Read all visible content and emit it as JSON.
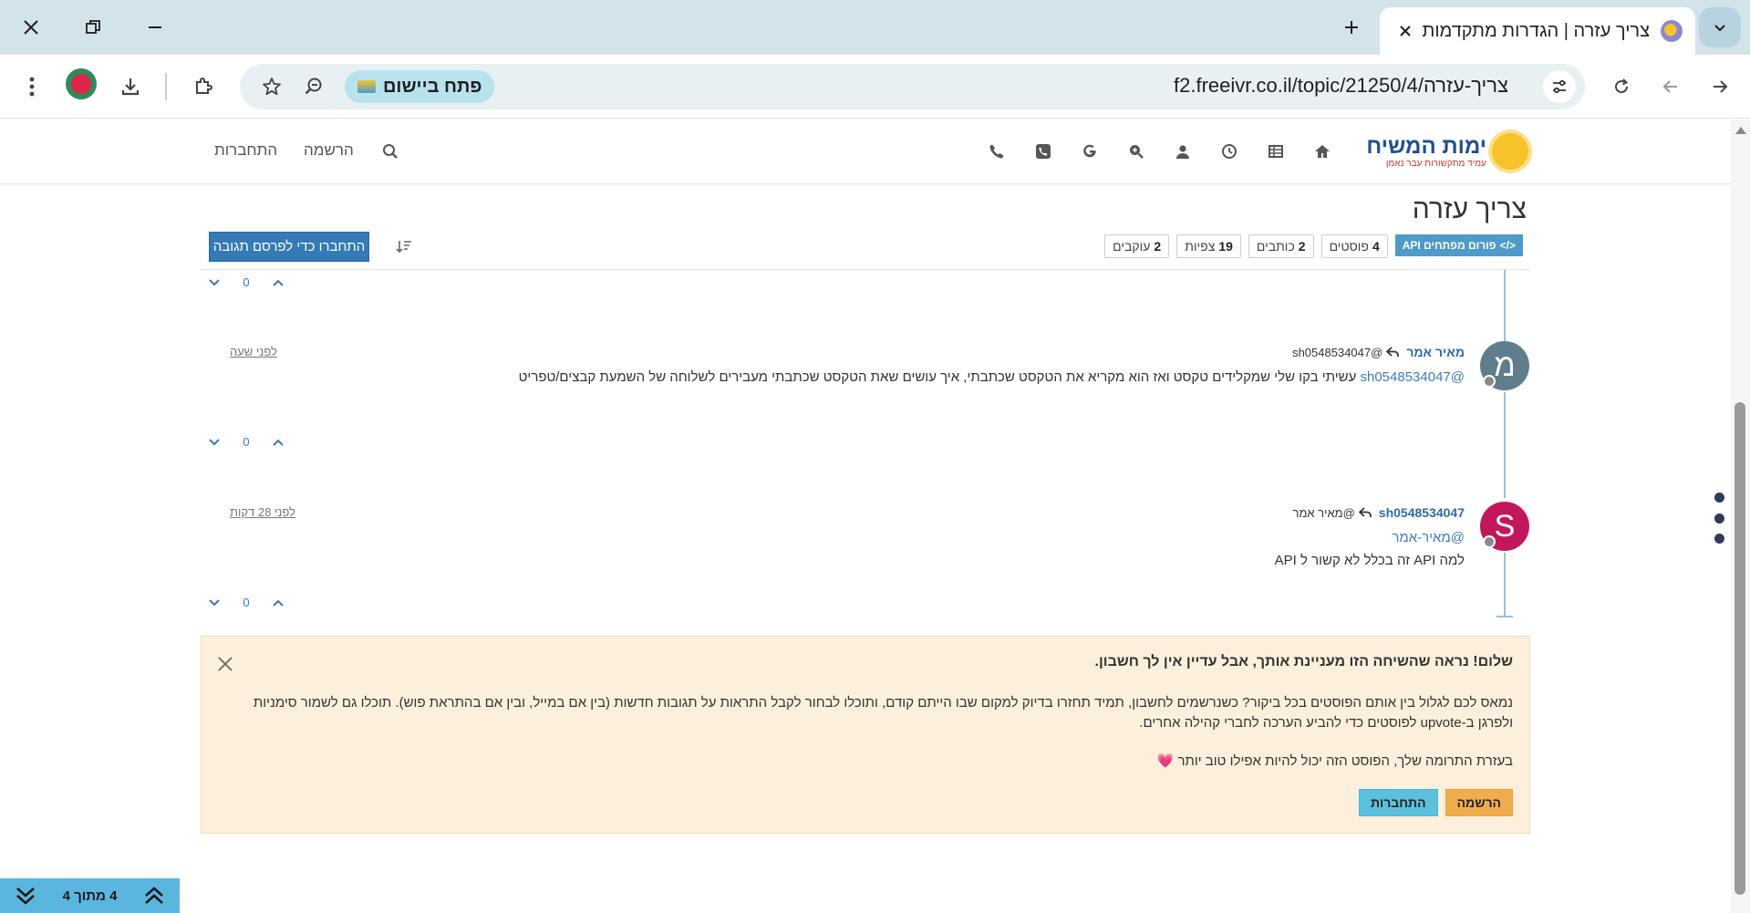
{
  "browser": {
    "tab_title": "צריך עזרה | הגדרות מתקדמות - ימות המשיח",
    "url": "f2.freeivr.co.il/topic/21250/4/צריך-עזרה",
    "open_app_label": "פתח ביישום"
  },
  "site": {
    "logo_main": "ימות המשיח",
    "logo_sub": "עמיד מתקשורות עבר נאמן",
    "register_link": "הרשמה",
    "login_link": "התחברות"
  },
  "topic": {
    "title": "צריך עזרה",
    "category_badge": "פורום מפתחים API",
    "stats": [
      {
        "count": "4",
        "label": "פוסטים"
      },
      {
        "count": "2",
        "label": "כותבים"
      },
      {
        "count": "19",
        "label": "צפיות"
      },
      {
        "count": "2",
        "label": "עוקבים"
      }
    ],
    "reply_button": "התחברו כדי לפרסם תגובה"
  },
  "posts": [
    {
      "votes": "0"
    },
    {
      "author": "מאיר אמר",
      "avatar_letter": "מ",
      "avatar_color": "#607d8b",
      "reply_to": "@sh0548534047",
      "time": "לפני שעה",
      "mention": "@sh0548534047",
      "body": " עשיתי בקו שלי שמקלידים טקסט ואז הוא מקריא את הטקסט שכתבתי, איך עושים שאת הטקסט שכתבתי מעבירים לשלוחה של השמעת קבצים/טפריט",
      "votes": "0"
    },
    {
      "author": "sh0548534047",
      "avatar_letter": "S",
      "avatar_color": "#c2185b",
      "reply_to": "@מאיר אמר",
      "time": "לפני 28 דקות",
      "mention": "@מאיר-אמר",
      "body": "למה API זה בכלל לא קשור ל API",
      "votes": "0"
    }
  ],
  "alert": {
    "title": "שלום! נראה שהשיחה הזו מעניינת אותך, אבל עדיין אין לך חשבון.",
    "text": "נמאס לכם לגלול בין אותם הפוסטים בכל ביקור? כשנרשמים לחשבון, תמיד תחזרו בדיוק למקום שבו הייתם קודם, ותוכלו לבחור לקבל התראות על תגובות חדשות (בין אם במייל, ובין אם בהתראת פוש). תוכלו גם לשמור סימניות ולפרגן ב-upvote לפוסטים כדי להביע הערכה לחברי קהילה אחרים.",
    "text2": "בעזרת התרומה שלך, הפוסט הזה יכול להיות אפילו טוב יותר",
    "heart": "💗",
    "register_button": "הרשמה",
    "login_button": "התחברות"
  },
  "pager": {
    "label": "4 מתוך 4"
  },
  "colors": {
    "accent": "#337ab7",
    "alert_bg": "#fcf0dc",
    "timeline": "#9fbfd6"
  }
}
